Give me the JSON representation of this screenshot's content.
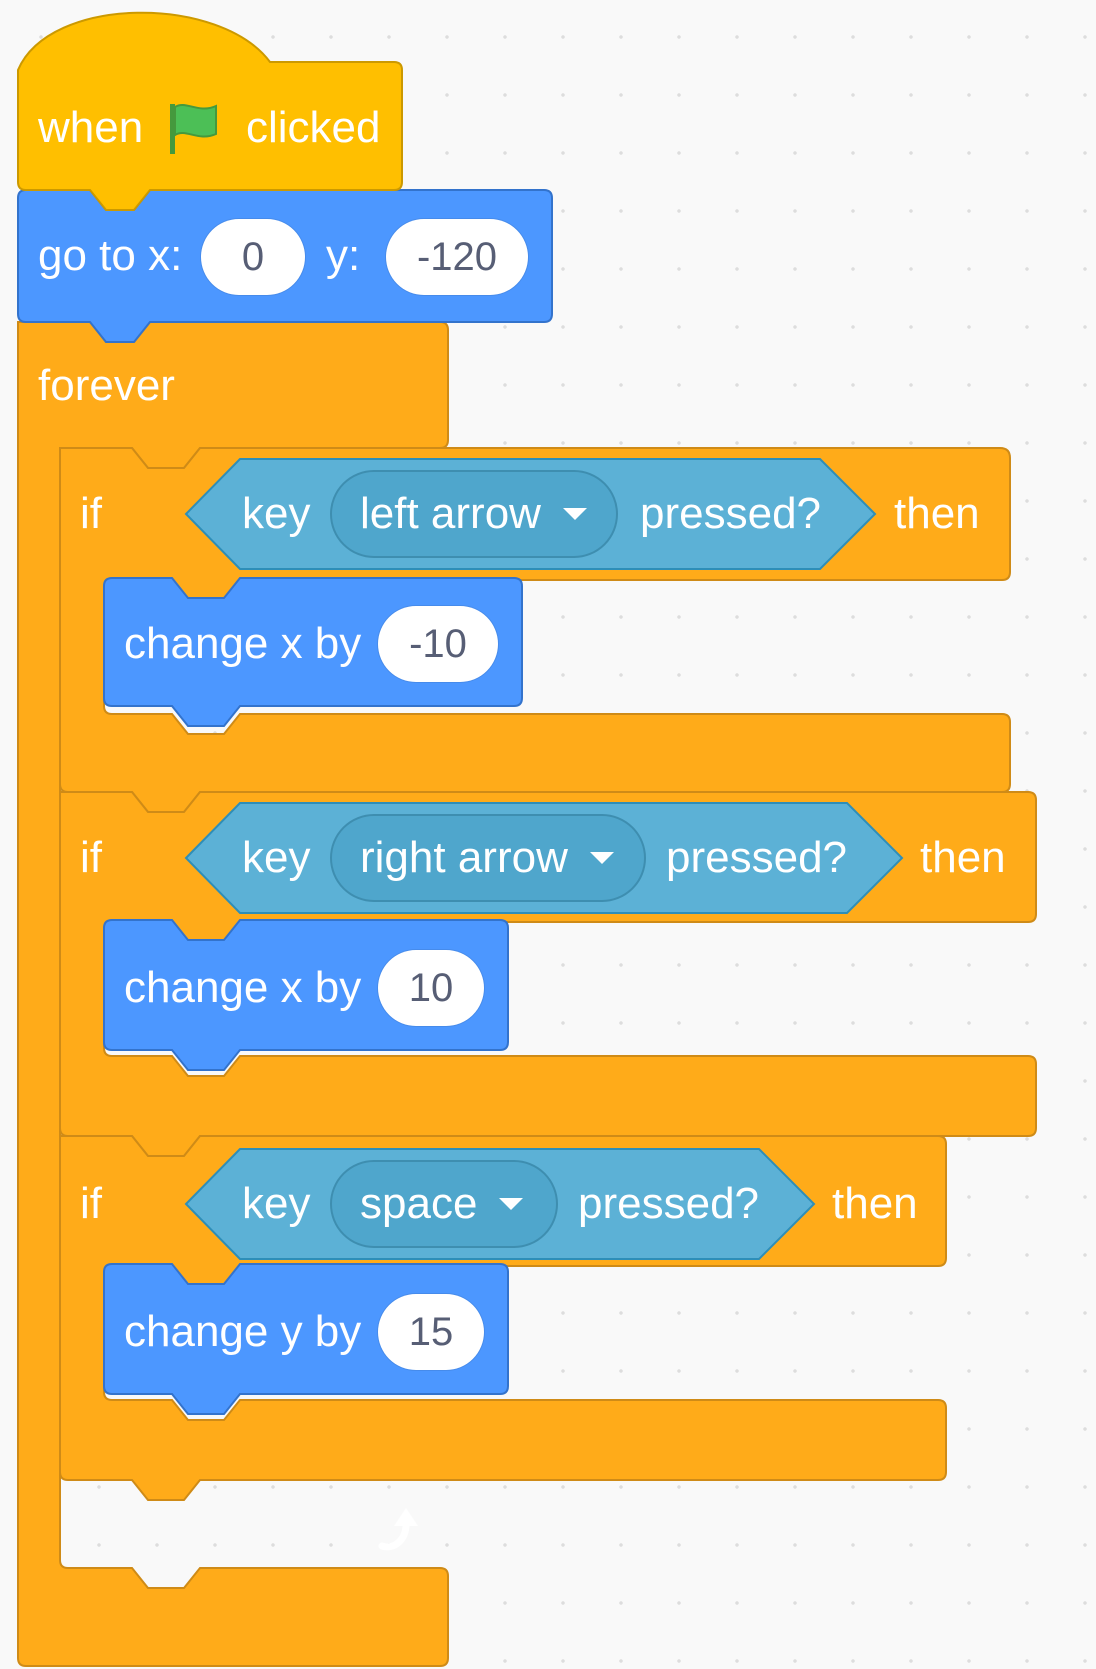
{
  "hat_block": {
    "when_label": "when",
    "flag_icon": "green-flag-icon",
    "clicked_label": "clicked"
  },
  "goto_block": {
    "label": "go to x:",
    "x_value": "0",
    "y_label": "y:",
    "y_value": "-120"
  },
  "forever_block": {
    "label": "forever",
    "loop_icon": "loop-arrow-icon"
  },
  "if_blocks": [
    {
      "if_label": "if",
      "key_label": "key",
      "key_option": "left arrow",
      "pressed_label": "pressed?",
      "then_label": "then",
      "action_label": "change x by",
      "action_value": "-10"
    },
    {
      "if_label": "if",
      "key_label": "key",
      "key_option": "right arrow",
      "pressed_label": "pressed?",
      "then_label": "then",
      "action_label": "change x by",
      "action_value": "10"
    },
    {
      "if_label": "if",
      "key_label": "key",
      "key_option": "space",
      "pressed_label": "pressed?",
      "then_label": "then",
      "action_label": "change y by",
      "action_value": "15"
    }
  ],
  "colors": {
    "events": "#ffbf00",
    "control": "#ffab19",
    "control_border": "#cf8b17",
    "motion": "#4c97ff",
    "motion_border": "#3373cc",
    "sensing": "#5cb1d6",
    "sensing_border": "#2e8eb8",
    "flag": "#4cbf56"
  }
}
